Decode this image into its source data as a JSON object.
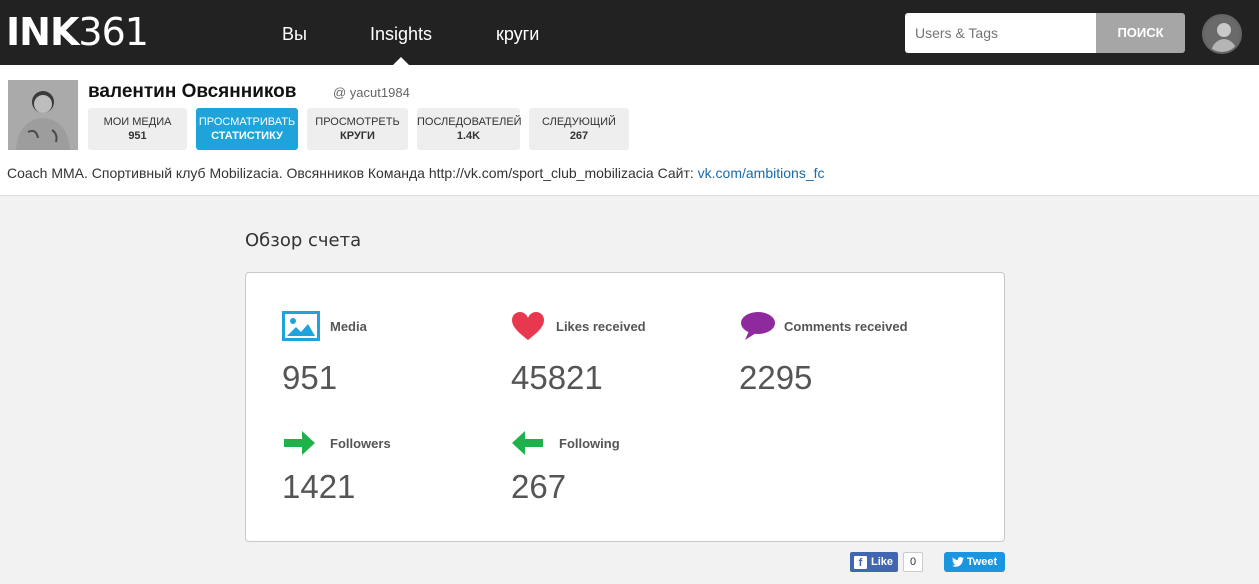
{
  "logo": {
    "bold": "INK",
    "light": "361"
  },
  "nav": {
    "you": "Вы",
    "insights": "Insights",
    "circles": "круги"
  },
  "search": {
    "placeholder": "Users & Tags",
    "button": "ПОИСК"
  },
  "profile": {
    "name": "валентин Овсянников",
    "handle": "@ yacut1984",
    "buttons": [
      {
        "label": "МОИ МЕДИА",
        "value": "951"
      },
      {
        "label": "ПРОСМАТРИВАТЬ",
        "value": "СТАТИСТИКУ"
      },
      {
        "label": "ПРОСМОТРЕТЬ",
        "value": "КРУГИ"
      },
      {
        "label": "ПОСЛЕДОВАТЕЛЕЙ",
        "value": "1.4K"
      },
      {
        "label": "СЛЕДУЮЩИЙ",
        "value": "267"
      }
    ],
    "bio_text": "Coach MMA. Спортивный клуб Mobilizacia. Овсянников Команда http://vk.com/sport_club_mobilizacia Сайт: ",
    "bio_link": "vk.com/ambitions_fc"
  },
  "overview": {
    "title": "Обзор счета",
    "metrics": {
      "media": {
        "label": "Media",
        "value": "951",
        "icon": "image-icon",
        "color": "#1fa3db"
      },
      "likes": {
        "label": "Likes received",
        "value": "45821",
        "icon": "heart-icon",
        "color": "#e8384f"
      },
      "comments": {
        "label": "Comments received",
        "value": "2295",
        "icon": "speech-bubble-icon",
        "color": "#8e2a9e"
      },
      "followers": {
        "label": "Followers",
        "value": "1421",
        "icon": "arrow-right-icon",
        "color": "#1fb24a"
      },
      "following": {
        "label": "Following",
        "value": "267",
        "icon": "arrow-left-icon",
        "color": "#1fb24a"
      }
    }
  },
  "social": {
    "like_label": "Like",
    "like_count": "0",
    "tweet_label": "Tweet"
  },
  "colors": {
    "accent": "#1fa3db",
    "topbar": "#222222"
  }
}
